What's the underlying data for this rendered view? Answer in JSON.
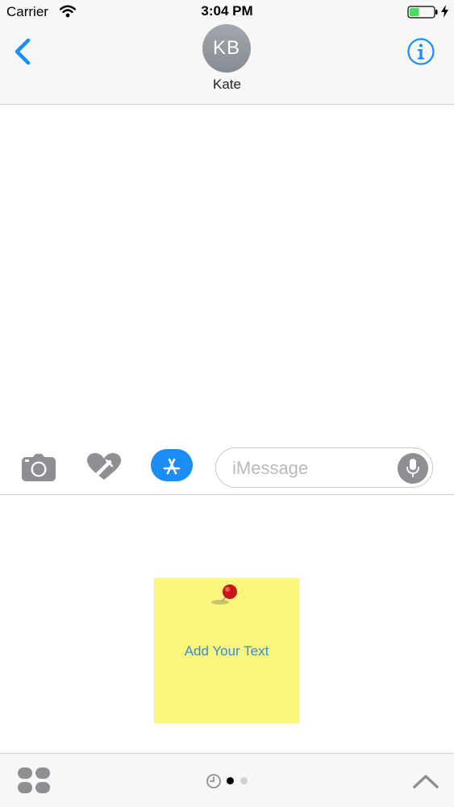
{
  "status_bar": {
    "carrier": "Carrier",
    "time": "3:04 PM",
    "wifi_icon": "wifi-icon",
    "battery_icon": "battery-charging-icon",
    "battery_level": 0.4,
    "charging_icon": "bolt-icon"
  },
  "header": {
    "back_icon": "chevron-left-icon",
    "avatar_initials": "KB",
    "contact_name": "Kate",
    "info_icon": "info-icon"
  },
  "compose": {
    "camera_icon": "camera-icon",
    "digital_touch_icon": "heart-touch-icon",
    "appstore_icon": "app-store-icon",
    "placeholder": "iMessage",
    "value": "",
    "mic_icon": "microphone-icon"
  },
  "app_drawer": {
    "sticky_note_text": "Add Your Text",
    "pin_icon": "push-pin-icon"
  },
  "bottom_bar": {
    "app_grid_icon": "app-grid-icon",
    "recents_icon": "clock-icon",
    "page_count": 2,
    "active_page": 1,
    "expand_icon": "chevron-up-icon"
  },
  "colors": {
    "accent": "#1a8ef5",
    "sticky_note": "#fdf67e",
    "sticky_text": "#2e8fd6",
    "avatar": "#8e949b",
    "icon_gray": "#8e8e93",
    "battery_fill": "#4cd964"
  }
}
